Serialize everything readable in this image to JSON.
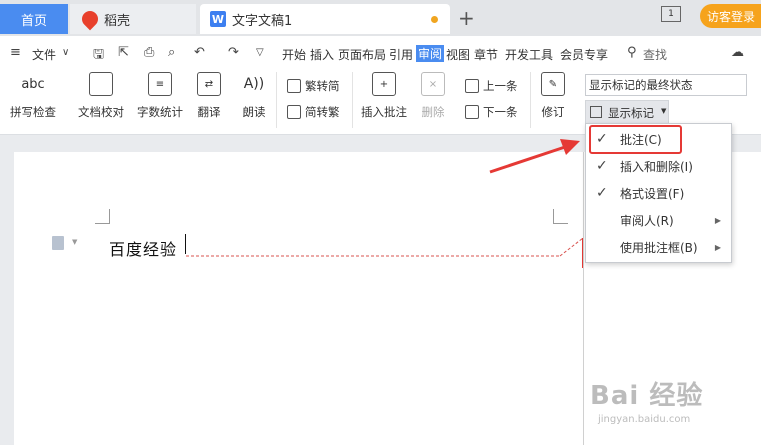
{
  "tabs": {
    "home": "首页",
    "daoke": "稻壳",
    "doc": "文字文稿1",
    "doc_logo": "W"
  },
  "titlebar": {
    "window_indicator": "1",
    "login": "访客登录"
  },
  "menu": {
    "file": "文件",
    "items": [
      "开始",
      "插入",
      "页面布局",
      "引用",
      "审阅",
      "视图",
      "章节",
      "开发工具",
      "会员专享"
    ],
    "search": "查找"
  },
  "ribbon": {
    "spell_check_icon": "abc",
    "spell_check": "拼写检查",
    "doc_proof": "文档校对",
    "word_count": "字数统计",
    "translate": "翻译",
    "read_aloud": "朗读",
    "trad_convert": "繁转简",
    "simp_convert": "简转繁",
    "insert_comment": "插入批注",
    "delete": "删除",
    "prev": "上一条",
    "next": "下一条",
    "revise": "修订",
    "status_select": "显示标记的最终状态",
    "show_marks": "显示标记"
  },
  "document": {
    "text": "百度经验"
  },
  "dropdown": {
    "items": [
      {
        "label": "批注(C)",
        "checked": true
      },
      {
        "label": "插入和删除(I)",
        "checked": true
      },
      {
        "label": "格式设置(F)",
        "checked": true
      },
      {
        "label": "审阅人(R)",
        "checked": false,
        "submenu": true
      },
      {
        "label": "使用批注框(B)",
        "checked": false,
        "submenu": true
      }
    ]
  },
  "watermark": {
    "main": "Bai 经验",
    "sub": "jingyan.baidu.com"
  },
  "colors": {
    "accent": "#4a8cf0",
    "login": "#f6a31c",
    "highlight": "#e53935"
  }
}
